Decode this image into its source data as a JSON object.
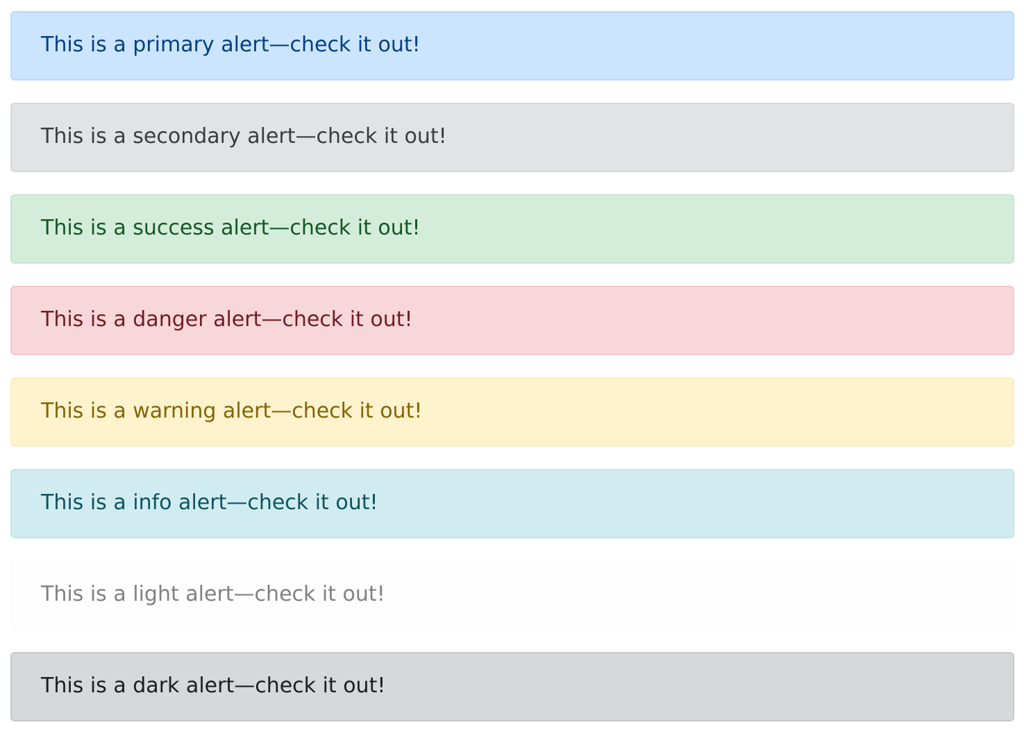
{
  "alerts": [
    {
      "id": "primary",
      "text": "This is a primary alert—check it out!",
      "background": "#cce5ff",
      "border": "#b8daff",
      "color": "#004085"
    },
    {
      "id": "secondary",
      "text": "This is a secondary alert—check it out!",
      "background": "#e2e3e5",
      "border": "#d6d8db",
      "color": "#383d41"
    },
    {
      "id": "success",
      "text": "This is a success alert—check it out!",
      "background": "#d4edda",
      "border": "#c3e6cb",
      "color": "#155724"
    },
    {
      "id": "danger",
      "text": "This is a danger alert—check it out!",
      "background": "#f8d7da",
      "border": "#f5c6cb",
      "color": "#721c24"
    },
    {
      "id": "warning",
      "text": "This is a warning alert—check it out!",
      "background": "#fff3cd",
      "border": "#ffeeba",
      "color": "#856404"
    },
    {
      "id": "info",
      "text": "This is a info alert—check it out!",
      "background": "#d1ecf1",
      "border": "#bee5eb",
      "color": "#0c5460"
    },
    {
      "id": "light",
      "text": "This is a light alert—check it out!",
      "background": "#fefefe",
      "border": "#fdfdfe",
      "color": "#818182"
    },
    {
      "id": "dark",
      "text": "This is a dark alert—check it out!",
      "background": "#d6d8d9",
      "border": "#c6c8ca",
      "color": "#1b1e21"
    }
  ]
}
